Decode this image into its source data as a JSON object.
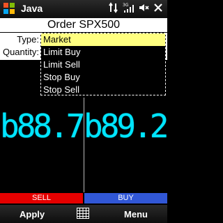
{
  "statusbar": {
    "title": "Java",
    "icons": [
      "windows-logo-icon",
      "network-arrows-icon",
      "3g-signal-icon",
      "volume-off-icon",
      "close-icon"
    ]
  },
  "order": {
    "title": "Order SPX500",
    "type_label": "Type:",
    "quantity_label": "Quantity:",
    "type_value": "Market"
  },
  "type_options": [
    "Market",
    "Limit Buy",
    "Limit Sell",
    "Stop Buy",
    "Stop Sell"
  ],
  "quotes": {
    "sell_display": "b88.7",
    "buy_display": "b89.2"
  },
  "trade": {
    "sell_label": "SELL",
    "buy_label": "BUY"
  },
  "softkeys": {
    "left": "Apply",
    "right": "Menu"
  },
  "colors": {
    "accent_cyan": "#00e5ff",
    "sell_red": "#e60000",
    "buy_blue": "#3157d6",
    "selection_yellow": "#ffff80"
  }
}
